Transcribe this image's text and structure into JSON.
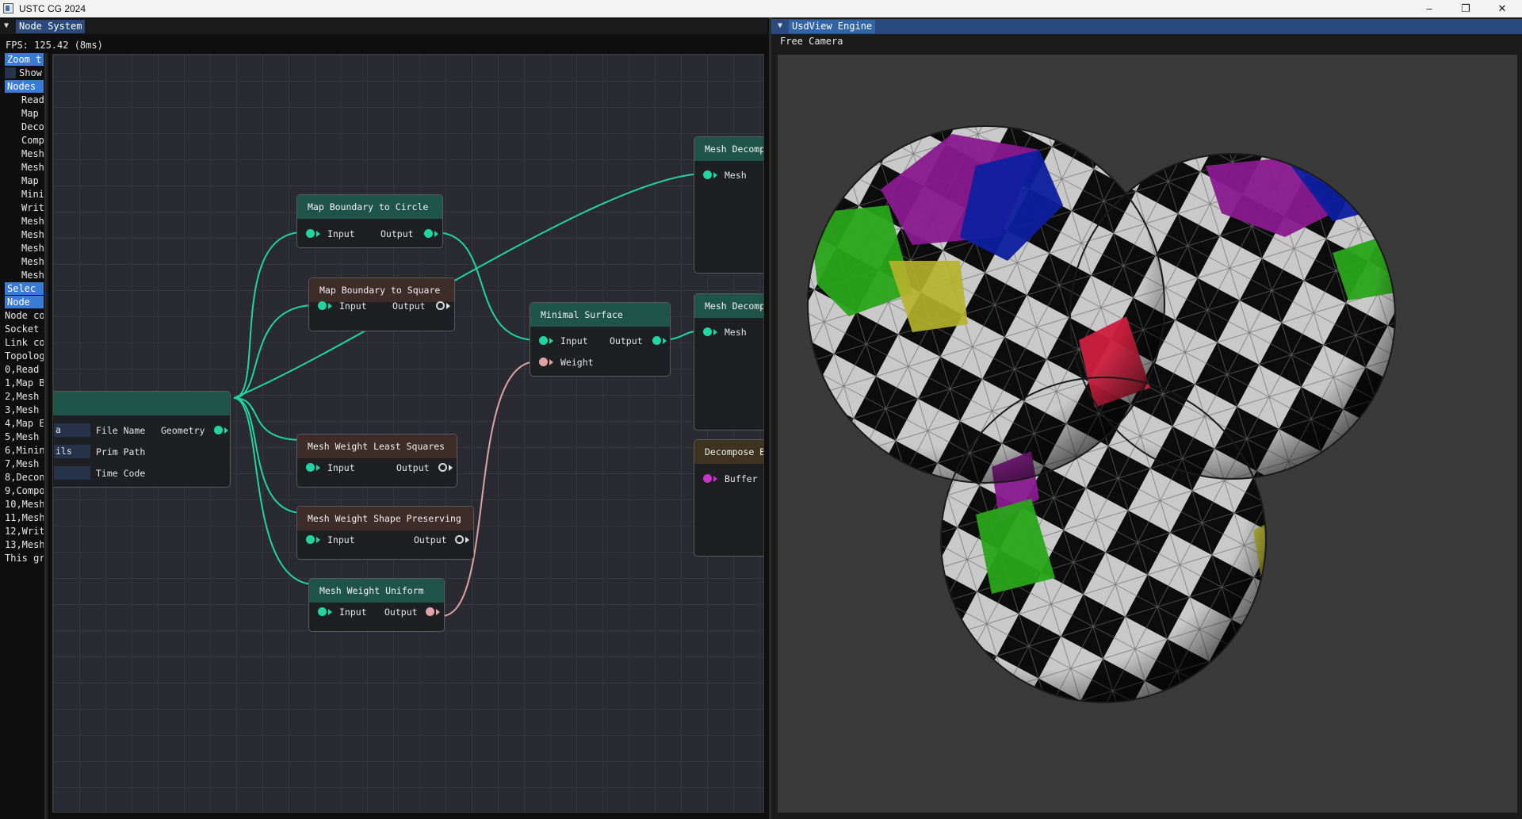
{
  "window": {
    "title": "USTC CG 2024",
    "minimize": "–",
    "restore": "❐",
    "close": "✕"
  },
  "node_system": {
    "tab_title": "Node System",
    "collapse_icon": "triangle-down-icon",
    "fps_text": "FPS: 125.42 (8ms)",
    "sidebar": [
      {
        "text": "Zoom t",
        "style": "blue"
      },
      {
        "text": "Show",
        "style": "checkbox"
      },
      {
        "text": "Nodes",
        "style": "blue"
      },
      {
        "text": "Read",
        "style": "indent"
      },
      {
        "text": "Map",
        "style": "indent"
      },
      {
        "text": "Deco",
        "style": "indent"
      },
      {
        "text": "Comp",
        "style": "indent"
      },
      {
        "text": "Mesh",
        "style": "indent"
      },
      {
        "text": "Mesh",
        "style": "indent"
      },
      {
        "text": "Map",
        "style": "indent"
      },
      {
        "text": "Mini",
        "style": "indent"
      },
      {
        "text": "Writ",
        "style": "indent"
      },
      {
        "text": "Mesh",
        "style": "indent"
      },
      {
        "text": "Mesh",
        "style": "indent"
      },
      {
        "text": "Mesh",
        "style": "indent"
      },
      {
        "text": "Mesh",
        "style": "indent"
      },
      {
        "text": "Mesh",
        "style": "indent"
      },
      {
        "text": "Selec",
        "style": "blue"
      },
      {
        "text": "Node",
        "style": "blue"
      },
      {
        "text": "Node co",
        "style": "plain"
      },
      {
        "text": "Socket",
        "style": "plain"
      },
      {
        "text": "Link co",
        "style": "plain"
      },
      {
        "text": "Topolog",
        "style": "plain"
      },
      {
        "text": "0,Read",
        "style": "plain"
      },
      {
        "text": "1,Map B",
        "style": "plain"
      },
      {
        "text": "2,Mesh",
        "style": "plain"
      },
      {
        "text": "3,Mesh",
        "style": "plain"
      },
      {
        "text": "4,Map E",
        "style": "plain"
      },
      {
        "text": "5,Mesh",
        "style": "plain"
      },
      {
        "text": "6,Minin",
        "style": "plain"
      },
      {
        "text": "7,Mesh",
        "style": "plain"
      },
      {
        "text": "8,Decon",
        "style": "plain"
      },
      {
        "text": "9,Compo",
        "style": "plain"
      },
      {
        "text": "10,Mesh",
        "style": "plain"
      },
      {
        "text": "11,Mesh",
        "style": "plain"
      },
      {
        "text": "12,Writ",
        "style": "plain"
      },
      {
        "text": "13,Mesh",
        "style": "plain"
      },
      {
        "text": "This gr",
        "style": "plain"
      }
    ],
    "nodes": {
      "read_usd": {
        "field_1": "a",
        "field_2": "ils",
        "field_3": "",
        "in_1": "File Name",
        "in_2": "Prim Path",
        "in_3": "Time Code",
        "out_1": "Geometry"
      },
      "map_circle": {
        "title": "Map Boundary to Circle",
        "in": "Input",
        "out": "Output"
      },
      "map_square": {
        "title": "Map Boundary to Square",
        "in": "Input",
        "out": "Output"
      },
      "minimal_surface": {
        "title": "Minimal Surface",
        "in_1": "Input",
        "in_2": "Weight",
        "out": "Output"
      },
      "least_squares": {
        "title": "Mesh Weight Least Squares",
        "in": "Input",
        "out": "Output"
      },
      "shape_preserving": {
        "title": "Mesh Weight Shape Preserving",
        "in": "Input",
        "out": "Output"
      },
      "uniform": {
        "title": "Mesh Weight Uniform",
        "in": "Input",
        "out": "Output"
      },
      "decompose_1": {
        "title": "Mesh Decomp",
        "in": "Mesh"
      },
      "decompose_2": {
        "title": "Mesh Decomp",
        "in": "Mesh"
      },
      "decompose_buffer": {
        "title": "Decompose B",
        "in": "Buffer"
      }
    }
  },
  "viewer": {
    "tab_title": "UsdView Engine",
    "collapse_icon": "triangle-down-icon",
    "camera_mode": "Free Camera"
  },
  "colors": {
    "link_teal": "#1fd6a0",
    "link_pink": "#e0a3a3",
    "link_magenta": "#cc33cc",
    "tab_blue": "#3a7bd5",
    "canvas_bg": "#2a2a33"
  }
}
